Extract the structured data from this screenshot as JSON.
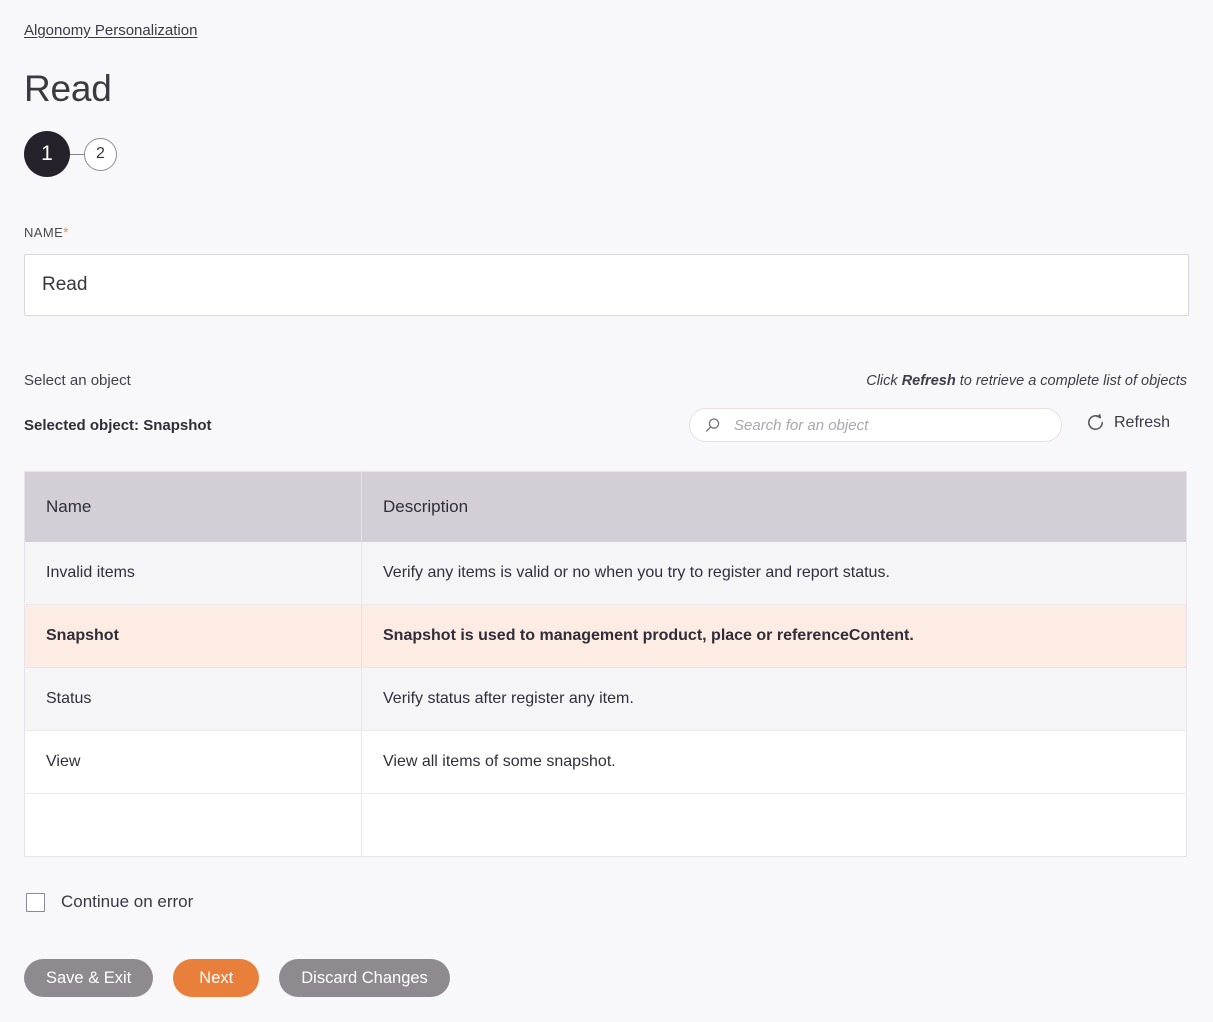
{
  "breadcrumb": {
    "label": "Algonomy Personalization"
  },
  "page_title": "Read",
  "stepper": {
    "steps": [
      {
        "label": "1",
        "state": "active"
      },
      {
        "label": "2",
        "state": "inactive"
      }
    ]
  },
  "name_field": {
    "label": "NAME",
    "required_marker": "*",
    "value": "Read",
    "placeholder": ""
  },
  "object_section": {
    "select_label": "Select an object",
    "hint_prefix": "Click ",
    "hint_bold": "Refresh",
    "hint_suffix": " to retrieve a complete list of objects",
    "selected_object": "Selected object: Snapshot",
    "search_placeholder": "Search for an object",
    "search_value": "",
    "refresh_label": "Refresh"
  },
  "table": {
    "columns": [
      "Name",
      "Description"
    ],
    "rows": [
      {
        "name": "Invalid items",
        "description": "Verify any items is valid or no when you try to register and report status.",
        "selected": false
      },
      {
        "name": "Snapshot",
        "description": "Snapshot is used to management product, place or referenceContent.",
        "selected": true
      },
      {
        "name": "Status",
        "description": "Verify status after register any item.",
        "selected": false
      },
      {
        "name": "View",
        "description": "View all items of some snapshot.",
        "selected": false
      }
    ]
  },
  "continue_on_error": {
    "label": "Continue on error",
    "checked": false
  },
  "buttons": {
    "save_exit": "Save & Exit",
    "next": "Next",
    "discard": "Discard Changes"
  },
  "colors": {
    "accent_orange": "#e8803c",
    "button_grey": "#8e8a8f",
    "selected_row_bg": "#fdece3",
    "table_header_bg": "#d4cfd6",
    "page_bg": "#f8f8fa",
    "step_active_bg": "#26222c"
  }
}
